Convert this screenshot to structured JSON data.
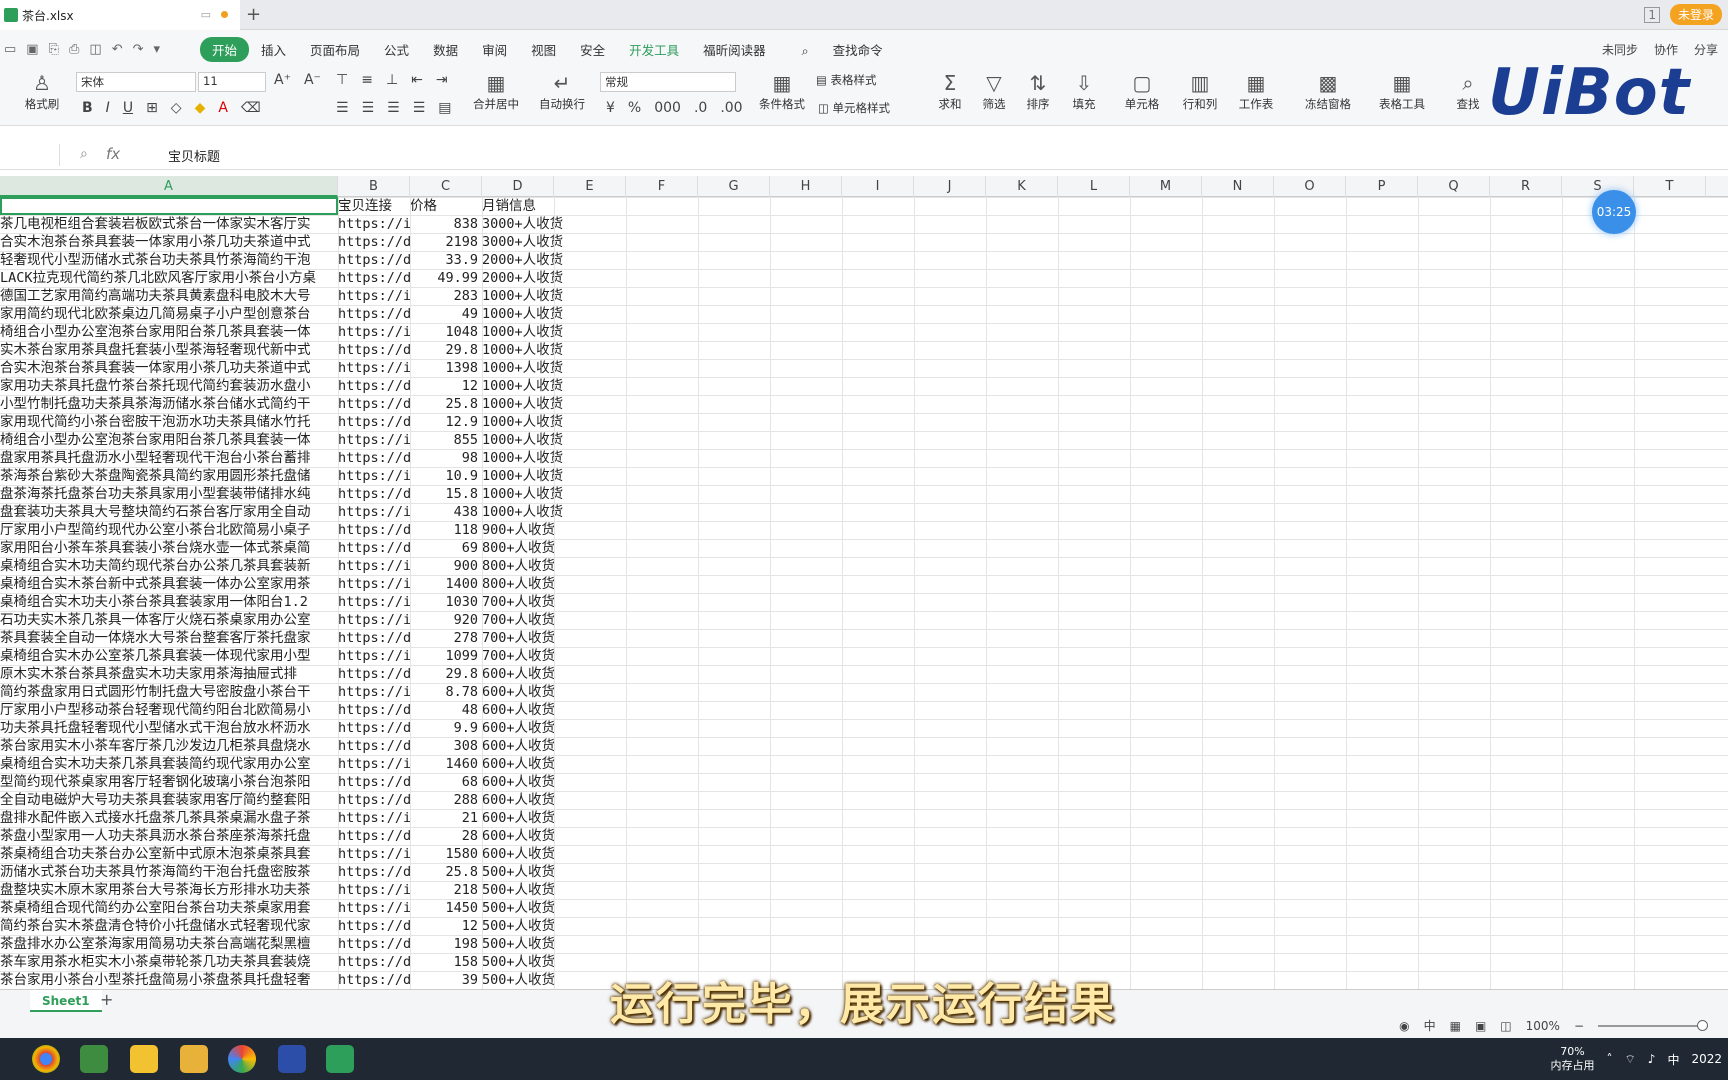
{
  "titlebar": {
    "file_name": "茶台.xlsx",
    "login": "未登录"
  },
  "menu": {
    "items": [
      "开始",
      "插入",
      "页面布局",
      "公式",
      "数据",
      "审阅",
      "视图",
      "安全",
      "开发工具",
      "福昕阅读器"
    ],
    "search": "查找命令",
    "right": [
      "未同步",
      "协作",
      "分享"
    ]
  },
  "ribbon": {
    "format_brush": "格式刷",
    "font": "宋体",
    "size": "11",
    "number_format": "常规",
    "merge": "合并居中",
    "wrap": "自动换行",
    "cond_format": "条件格式",
    "table_style": "表格样式",
    "cell_style": "单元格样式",
    "sum": "求和",
    "filter": "筛选",
    "sort": "排序",
    "fill": "填充",
    "cell": "单元格",
    "rowcol": "行和列",
    "worksheet": "工作表",
    "freeze": "冻结窗格",
    "table_tools": "表格工具",
    "find": "查找"
  },
  "watermark": "UiBot",
  "formula": {
    "fx": "fx",
    "value": "宝贝标题"
  },
  "columns": [
    "A",
    "B",
    "C",
    "D",
    "E",
    "F",
    "G",
    "H",
    "I",
    "J",
    "K",
    "L",
    "M",
    "N",
    "O",
    "P",
    "Q",
    "R",
    "S",
    "T"
  ],
  "header_row": {
    "b": "宝贝连接",
    "c": "价格",
    "d": "月销信息"
  },
  "rows": [
    {
      "a": "茶几电视柜组合套装岩板欧式茶台一体家实木客厅实",
      "b": "https://i",
      "c": "838",
      "d": "3000+人收货"
    },
    {
      "a": "合实木泡茶台茶具套装一体家用小茶几功夫茶道中式",
      "b": "https://d",
      "c": "2198",
      "d": "3000+人收货"
    },
    {
      "a": "轻奢现代小型沥储水式茶台功夫茶具竹茶海简约干泡",
      "b": "https://d",
      "c": "33.9",
      "d": "2000+人收货"
    },
    {
      "a": "LACK拉克现代简约茶几北欧风客厅家用小茶台小方桌",
      "b": "https://d",
      "c": "49.99",
      "d": "2000+人收货"
    },
    {
      "a": "德国工艺家用简约高端功夫茶具黄素盘科电胶木大号",
      "b": "https://i",
      "c": "283",
      "d": "1000+人收货"
    },
    {
      "a": "家用简约现代北欧茶桌边几简易桌子小户型创意茶台",
      "b": "https://d",
      "c": "49",
      "d": "1000+人收货"
    },
    {
      "a": "椅组合小型办公室泡茶台家用阳台茶几茶具套装一体",
      "b": "https://i",
      "c": "1048",
      "d": "1000+人收货"
    },
    {
      "a": "实木茶台家用茶具盘托套装小型茶海轻奢现代新中式",
      "b": "https://d",
      "c": "29.8",
      "d": "1000+人收货"
    },
    {
      "a": "合实木泡茶台茶具套装一体家用小茶几功夫茶道中式",
      "b": "https://i",
      "c": "1398",
      "d": "1000+人收货"
    },
    {
      "a": "家用功夫茶具托盘竹茶台茶托现代简约套装沥水盘小",
      "b": "https://d",
      "c": "12",
      "d": "1000+人收货"
    },
    {
      "a": "小型竹制托盘功夫茶具茶海沥储水茶台储水式简约干",
      "b": "https://d",
      "c": "25.8",
      "d": "1000+人收货"
    },
    {
      "a": "家用现代简约小茶台密胺干泡沥水功夫茶具储水竹托",
      "b": "https://d",
      "c": "12.9",
      "d": "1000+人收货"
    },
    {
      "a": "椅组合小型办公室泡茶台家用阳台茶几茶具套装一体",
      "b": "https://i",
      "c": "855",
      "d": "1000+人收货"
    },
    {
      "a": "盘家用茶具托盘沥水小型轻奢现代干泡台小茶台蓄排",
      "b": "https://d",
      "c": "98",
      "d": "1000+人收货"
    },
    {
      "a": "茶海茶台紫砂大茶盘陶瓷茶具简约家用圆形茶托盘储",
      "b": "https://i",
      "c": "10.9",
      "d": "1000+人收货"
    },
    {
      "a": "盘茶海茶托盘茶台功夫茶具家用小型套装带储排水纯",
      "b": "https://d",
      "c": "15.8",
      "d": "1000+人收货"
    },
    {
      "a": "盘套装功夫茶具大号整块简约石茶台客厅家用全自动",
      "b": "https://i",
      "c": "438",
      "d": "1000+人收货"
    },
    {
      "a": "厅家用小户型简约现代办公室小茶台北欧简易小桌子",
      "b": "https://d",
      "c": "118",
      "d": "900+人收货"
    },
    {
      "a": "家用阳台小茶车茶具套装小茶台烧水壶一体式茶桌简",
      "b": "https://d",
      "c": "69",
      "d": "800+人收货"
    },
    {
      "a": "桌椅组合实木功夫简约现代茶台办公茶几茶具套装新",
      "b": "https://i",
      "c": "900",
      "d": "800+人收货"
    },
    {
      "a": "桌椅组合实木茶台新中式茶具套装一体办公室家用茶",
      "b": "https://i",
      "c": "1400",
      "d": "800+人收货"
    },
    {
      "a": "桌椅组合实木功夫小茶台茶具套装家用一体阳台1.2",
      "b": "https://i",
      "c": "1030",
      "d": "700+人收货"
    },
    {
      "a": "石功夫实木茶几茶具一体客厅火烧石茶桌家用办公室",
      "b": "https://i",
      "c": "920",
      "d": "700+人收货"
    },
    {
      "a": "茶具套装全自动一体烧水大号茶台整套客厅茶托盘家",
      "b": "https://d",
      "c": "278",
      "d": "700+人收货"
    },
    {
      "a": "桌椅组合实木办公室茶几茶具套装一体现代家用小型",
      "b": "https://i",
      "c": "1099",
      "d": "700+人收货"
    },
    {
      "a": "  原木实木茶台茶具茶盘实木功夫家用茶海抽屉式排",
      "b": "https://d",
      "c": "29.8",
      "d": "600+人收货"
    },
    {
      "a": "简约茶盘家用日式圆形竹制托盘大号密胺盘小茶台干",
      "b": "https://i",
      "c": "8.78",
      "d": "600+人收货"
    },
    {
      "a": "厅家用小户型移动茶台轻奢现代简约阳台北欧简易小",
      "b": "https://d",
      "c": "48",
      "d": "600+人收货"
    },
    {
      "a": "功夫茶具托盘轻奢现代小型储水式干泡台放水杯沥水",
      "b": "https://d",
      "c": "9.9",
      "d": "600+人收货"
    },
    {
      "a": "茶台家用实木小茶车客厅茶几沙发边几柜茶具盘烧水",
      "b": "https://d",
      "c": "308",
      "d": "600+人收货"
    },
    {
      "a": "桌椅组合实木功夫茶几茶具套装简约现代家用办公室",
      "b": "https://i",
      "c": "1460",
      "d": "600+人收货"
    },
    {
      "a": "型简约现代茶桌家用客厅轻奢钢化玻璃小茶台泡茶阳",
      "b": "https://d",
      "c": "68",
      "d": "600+人收货"
    },
    {
      "a": "全自动电磁炉大号功夫茶具套装家用客厅简约整套阳",
      "b": "https://d",
      "c": "288",
      "d": "600+人收货"
    },
    {
      "a": "盘排水配件嵌入式接水托盘茶几茶具茶桌漏水盘子茶",
      "b": "https://i",
      "c": "21",
      "d": "600+人收货"
    },
    {
      "a": "茶盘小型家用一人功夫茶具沥水茶台茶座茶海茶托盘",
      "b": "https://d",
      "c": "28",
      "d": "600+人收货"
    },
    {
      "a": "茶桌椅组合功夫茶台办公室新中式原木泡茶桌茶具套",
      "b": "https://i",
      "c": "1580",
      "d": "600+人收货"
    },
    {
      "a": "沥储水式茶台功夫茶具竹茶海简约干泡台托盘密胺茶",
      "b": "https://d",
      "c": "25.8",
      "d": "500+人收货"
    },
    {
      "a": "盘整块实木原木家用茶台大号茶海长方形排水功夫茶",
      "b": "https://i",
      "c": "218",
      "d": "500+人收货"
    },
    {
      "a": "茶桌椅组合现代简约办公室阳台茶台功夫茶桌家用套",
      "b": "https://i",
      "c": "1450",
      "d": "500+人收货"
    },
    {
      "a": "简约茶台实木茶盘清仓特价小托盘储水式轻奢现代家",
      "b": "https://d",
      "c": "12",
      "d": "500+人收货"
    },
    {
      "a": "茶盘排水办公室茶海家用简易功夫茶台高端花梨黑檀",
      "b": "https://d",
      "c": "198",
      "d": "500+人收货"
    },
    {
      "a": "茶车家用茶水柜实木小茶桌带轮茶几功夫茶具套装烧",
      "b": "https://d",
      "c": "158",
      "d": "500+人收货"
    },
    {
      "a": "茶台家用小茶台小型茶托盘简易小茶盘茶具托盘轻奢",
      "b": "https://d",
      "c": "39",
      "d": "500+人收货"
    }
  ],
  "timer": "03:25",
  "sheet": {
    "tab": "Sheet1",
    "add": "+"
  },
  "status": {
    "zoom": "100%",
    "ime": "中"
  },
  "subtitle": "运行完毕，展示运行结果",
  "taskbar": {
    "memory": "70%",
    "memory_label": "内存占用",
    "ime": "中",
    "year": "2022"
  }
}
